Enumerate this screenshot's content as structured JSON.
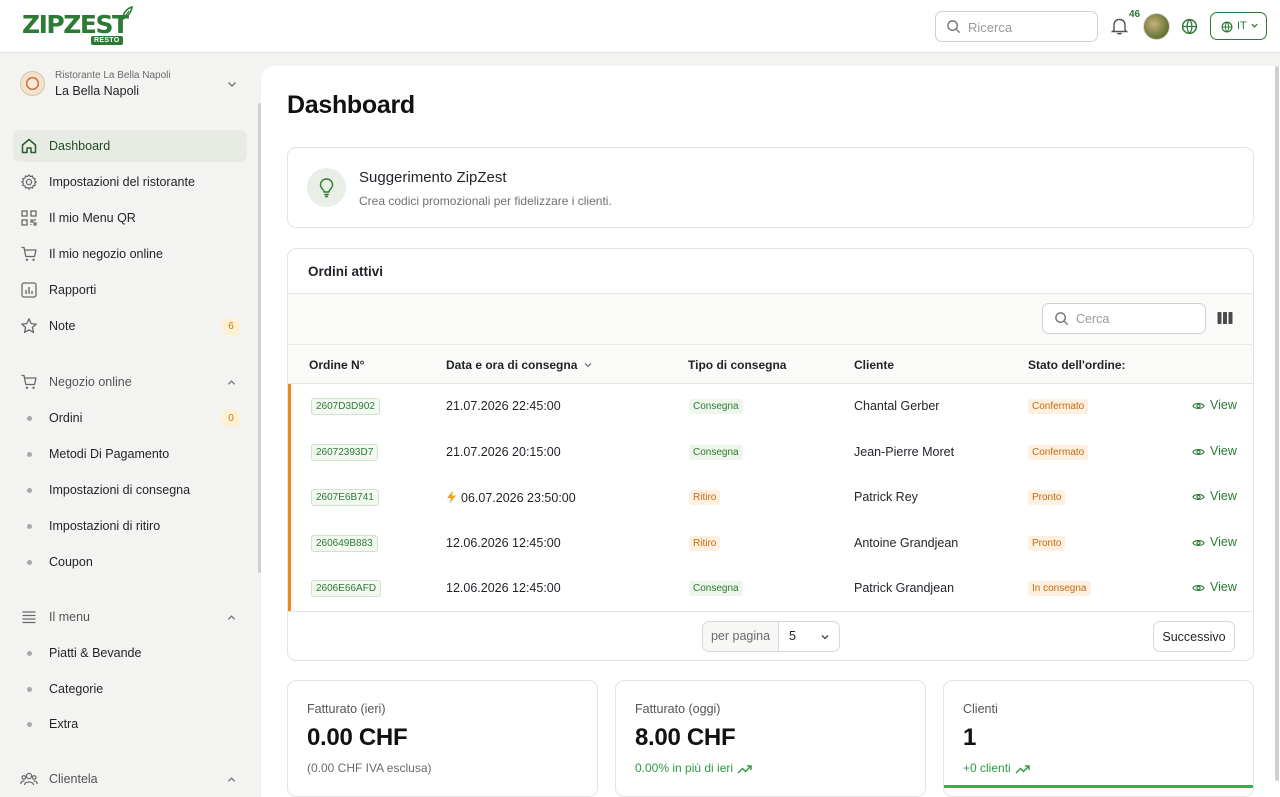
{
  "header": {
    "logo_text": "ZIPZEST",
    "logo_badge": "RESTO",
    "search_placeholder": "Ricerca",
    "notifications_count": "46",
    "language": "IT"
  },
  "restaurant": {
    "subtitle": "Ristorante La Bella Napoli",
    "name": "La Bella Napoli"
  },
  "sidebar": {
    "items": [
      {
        "label": "Dashboard"
      },
      {
        "label": "Impostazioni del ristorante"
      },
      {
        "label": "Il mio Menu QR"
      },
      {
        "label": "Il mio negozio online"
      },
      {
        "label": "Rapporti"
      },
      {
        "label": "Note",
        "badge": "6"
      }
    ],
    "online_shop": {
      "label": "Negozio online",
      "items": [
        {
          "label": "Ordini",
          "badge": "0"
        },
        {
          "label": "Metodi Di Pagamento"
        },
        {
          "label": "Impostazioni di consegna"
        },
        {
          "label": "Impostazioni di ritiro"
        },
        {
          "label": "Coupon"
        }
      ]
    },
    "menu": {
      "label": "Il menu",
      "items": [
        {
          "label": "Piatti & Bevande"
        },
        {
          "label": "Categorie"
        },
        {
          "label": "Extra"
        }
      ]
    },
    "customers": {
      "label": "Clientela"
    }
  },
  "main": {
    "title": "Dashboard",
    "tip": {
      "title": "Suggerimento ZipZest",
      "text": "Crea codici promozionali per fidelizzare i clienti."
    },
    "orders": {
      "title": "Ordini attivi",
      "search_placeholder": "Cerca",
      "columns": [
        "Ordine N°",
        "Data e ora di consegna",
        "Tipo di consegna",
        "Cliente",
        "Stato dell'ordine:"
      ],
      "rows": [
        {
          "id": "2607D3D902",
          "date": "21.07.2026 22:45:00",
          "type": "Consegna",
          "customer": "Chantal Gerber",
          "status": "Confermato",
          "action": "View",
          "urgent": false
        },
        {
          "id": "26072393D7",
          "date": "21.07.2026 20:15:00",
          "type": "Consegna",
          "customer": "Jean-Pierre Moret",
          "status": "Confermato",
          "action": "View",
          "urgent": false
        },
        {
          "id": "2607E6B741",
          "date": "06.07.2026 23:50:00",
          "type": "Ritiro",
          "customer": "Patrick Rey",
          "status": "Pronto",
          "action": "View",
          "urgent": true
        },
        {
          "id": "260649B883",
          "date": "12.06.2026 12:45:00",
          "type": "Ritiro",
          "customer": "Antoine Grandjean",
          "status": "Pronto",
          "action": "View",
          "urgent": false
        },
        {
          "id": "2606E66AFD",
          "date": "12.06.2026 12:45:00",
          "type": "Consegna",
          "customer": "Patrick Grandjean",
          "status": "In consegna",
          "action": "View",
          "urgent": false
        }
      ],
      "per_page_label": "per pagina",
      "per_page_value": "5",
      "next_label": "Successivo"
    },
    "stats": [
      {
        "label": "Fatturato (ieri)",
        "value": "0.00 CHF",
        "sub": "(0.00 CHF IVA esclusa)"
      },
      {
        "label": "Fatturato (oggi)",
        "value": "8.00 CHF",
        "sub": "0.00% in più di ieri"
      },
      {
        "label": "Clienti",
        "value": "1",
        "sub": "+0 clienti",
        "progress": 1.0
      }
    ]
  },
  "colors": {
    "brand": "#2d7a35",
    "accent_orange": "#e8891a",
    "positive": "#2d9a43"
  },
  "icons": [
    "search-icon",
    "bell-icon",
    "globe-icon",
    "chevron-down-icon",
    "home-icon",
    "gear-icon",
    "qr-icon",
    "cart-icon",
    "chart-icon",
    "star-icon",
    "list-icon",
    "users-icon",
    "lightbulb-icon",
    "columns-icon",
    "eye-icon",
    "bolt-icon",
    "trend-up-icon"
  ]
}
